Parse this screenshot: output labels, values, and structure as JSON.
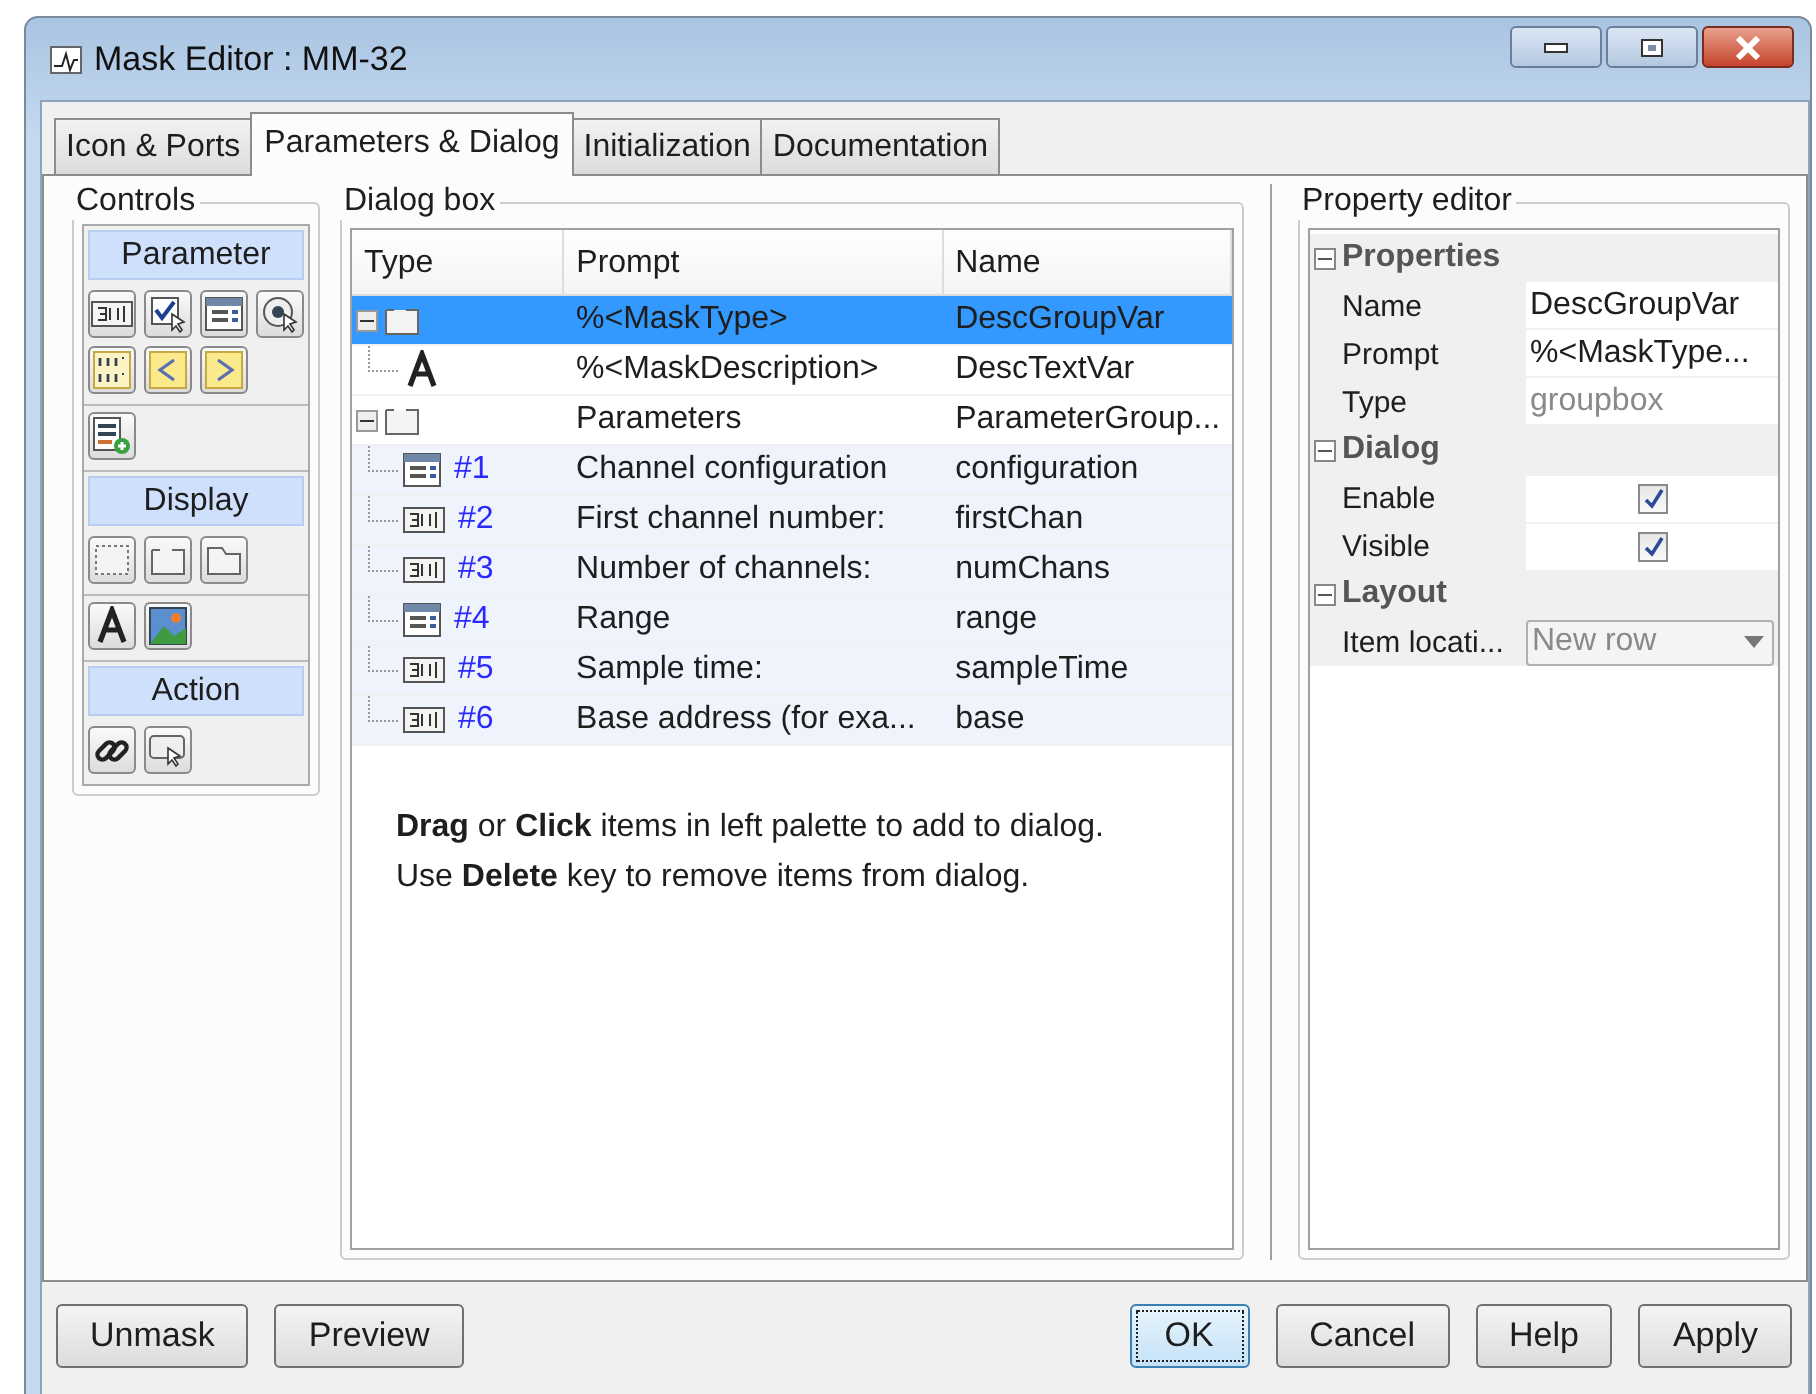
{
  "window": {
    "title": "Mask Editor : MM-32"
  },
  "tabs": [
    {
      "label": "Icon & Ports",
      "selected": false
    },
    {
      "label": "Parameters & Dialog",
      "selected": true
    },
    {
      "label": "Initialization",
      "selected": false
    },
    {
      "label": "Documentation",
      "selected": false
    }
  ],
  "controls": {
    "title": "Controls",
    "sections": [
      {
        "title": "Parameter"
      },
      {
        "title": "Display"
      },
      {
        "title": "Action"
      }
    ]
  },
  "dialog_box": {
    "title": "Dialog box",
    "columns": [
      "Type",
      "Prompt",
      "Name"
    ],
    "rows": [
      {
        "kind": "group",
        "prompt": "%<MaskType>",
        "name": "DescGroupVar",
        "selected": true,
        "expanded": true,
        "children": [
          {
            "kind": "text",
            "prompt": "%<MaskDescription>",
            "name": "DescTextVar",
            "selected": false
          }
        ]
      },
      {
        "kind": "group",
        "prompt": "Parameters",
        "name": "ParameterGroup...",
        "selected": false,
        "expanded": true,
        "children": [
          {
            "kind": "popup",
            "number": "#1",
            "prompt": "Channel configuration",
            "name": "configuration",
            "selected": false
          },
          {
            "kind": "edit",
            "number": "#2",
            "prompt": "First channel number:",
            "name": "firstChan",
            "selected": false
          },
          {
            "kind": "edit",
            "number": "#3",
            "prompt": "Number of channels:",
            "name": "numChans",
            "selected": false
          },
          {
            "kind": "popup",
            "number": "#4",
            "prompt": "Range",
            "name": "range",
            "selected": false
          },
          {
            "kind": "edit",
            "number": "#5",
            "prompt": "Sample time:",
            "name": "sampleTime",
            "selected": false
          },
          {
            "kind": "edit",
            "number": "#6",
            "prompt": "Base address (for exa...",
            "name": "base",
            "selected": false
          }
        ]
      }
    ],
    "hints": [
      "**Drag** or **Click** items in left palette to add to dialog.",
      "Use **Delete** key to remove items from dialog."
    ]
  },
  "property_editor": {
    "title": "Property editor",
    "sections": [
      {
        "title": "Properties",
        "expanded": true,
        "rows": [
          {
            "kind": "text",
            "label": "Name",
            "value": "DescGroupVar",
            "disabled": false
          },
          {
            "kind": "text",
            "label": "Prompt",
            "value": "%<MaskType...",
            "disabled": false
          },
          {
            "kind": "text",
            "label": "Type",
            "value": "groupbox",
            "disabled": true
          }
        ]
      },
      {
        "title": "Dialog",
        "expanded": true,
        "rows": [
          {
            "kind": "checkbox",
            "label": "Enable",
            "checked": true
          },
          {
            "kind": "checkbox",
            "label": "Visible",
            "checked": true
          }
        ]
      },
      {
        "title": "Layout",
        "expanded": true,
        "rows": [
          {
            "kind": "dropdown",
            "label": "Item locati...",
            "value": "New row",
            "disabled": true
          }
        ]
      }
    ]
  },
  "buttons_left": [
    {
      "label": "Unmask",
      "focused": false
    },
    {
      "label": "Preview",
      "focused": false
    }
  ],
  "buttons_right": [
    {
      "label": "OK",
      "focused": true
    },
    {
      "label": "Cancel",
      "focused": false
    },
    {
      "label": "Help",
      "focused": false
    },
    {
      "label": "Apply",
      "focused": false
    }
  ]
}
